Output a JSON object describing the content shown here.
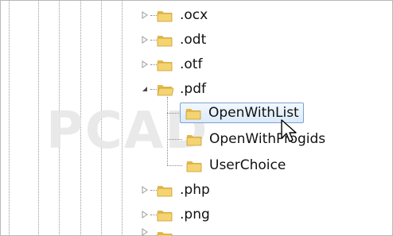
{
  "tree": {
    "items": [
      {
        "label": ".ocx",
        "expanded": false,
        "level": 1
      },
      {
        "label": ".odt",
        "expanded": false,
        "level": 1
      },
      {
        "label": ".otf",
        "expanded": false,
        "level": 1
      },
      {
        "label": ".pdf",
        "expanded": true,
        "level": 1,
        "children": [
          {
            "label": "OpenWithList",
            "selected": true
          },
          {
            "label": "OpenWithProgids",
            "selected": false
          },
          {
            "label": "UserChoice",
            "selected": false
          }
        ]
      },
      {
        "label": ".php",
        "expanded": false,
        "level": 1
      },
      {
        "label": ".png",
        "expanded": false,
        "level": 1
      }
    ]
  },
  "watermark": "PCAD",
  "colors": {
    "folder_fill": "#f4d371",
    "folder_shade": "#e3b94a",
    "selection_border": "#7da2ce",
    "selection_bg": "#dbeafb",
    "tree_lines": "#8a8a8a"
  },
  "icons": {
    "expander_collapsed": "chevron-right-icon",
    "expander_expanded": "triangle-down-icon",
    "folder": "folder-icon",
    "cursor": "mouse-pointer-icon"
  }
}
